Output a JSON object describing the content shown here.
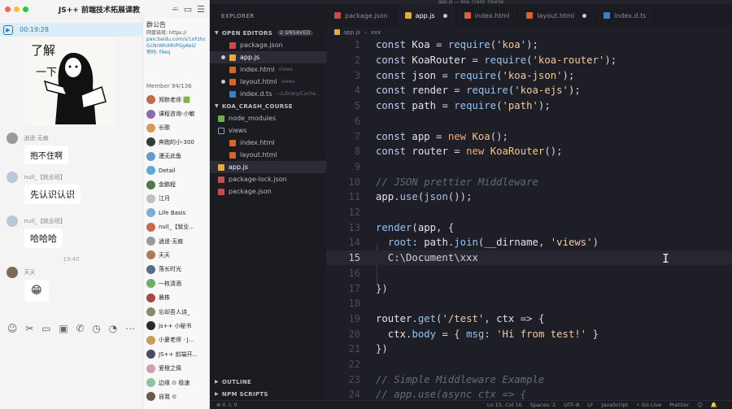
{
  "chat": {
    "title": "JS++ 前端技术拓展课教",
    "timer": "00:19:28",
    "sticker_text": [
      "了解",
      "一下"
    ],
    "messages": [
      {
        "sender": "逍遥·无痕",
        "text": "抱不住啊"
      },
      {
        "sender": "null_【就业班】",
        "text": "先认识认识"
      },
      {
        "sender": "null_【就业班】",
        "text": "哈哈哈"
      },
      {
        "sender": "天天",
        "text": "😁"
      }
    ],
    "time_divider": "19:40",
    "toolbar_icons": [
      "emoji-icon",
      "scissors-icon",
      "folder-icon",
      "image-icon",
      "phone-icon",
      "history-icon",
      "clock-icon",
      "more-icon"
    ],
    "group": {
      "notice_title": "群公告",
      "notice_lines": [
        "网盘链接: https://",
        "pan.baidu.com/s/1xFzhc",
        "GcNrWkd4hPGgAeI2",
        "密码: f4eq"
      ],
      "member_count": "Member 94/136",
      "members": [
        "郑默老师 🟩",
        "课程咨询-小敏",
        "长歌",
        "奔跑的小-300",
        "漫无此鱼",
        "Detail",
        "金鹏程",
        "江月",
        "Life Basis",
        "null_【就业...",
        "逍遥·无痕",
        "天天",
        "落长时光",
        "一枚清酒",
        "晨株",
        "忘却吾人诗_",
        "js++ 小秘书",
        "小夏老师 · J...",
        "JS++ 前端开...",
        "爱橙之佩",
        "边缘 ⊙ 极速",
        "自我 ⊙"
      ]
    }
  },
  "vscode": {
    "window_title": "app.js — koa_crash_course",
    "explorer_title": "EXPLORER",
    "open_editors": {
      "label": "OPEN EDITORS",
      "badge": "2 UNSAVED",
      "items": [
        {
          "name": "package.json",
          "hint": "",
          "icon": "json",
          "dirty": false
        },
        {
          "name": "app.js",
          "hint": "",
          "icon": "js",
          "dirty": true
        },
        {
          "name": "index.html",
          "hint": "views",
          "icon": "html",
          "dirty": false
        },
        {
          "name": "layout.html",
          "hint": "views",
          "icon": "html",
          "dirty": true
        },
        {
          "name": "index.d.ts",
          "hint": "~/Library/Cache...",
          "icon": "ts",
          "dirty": false
        }
      ]
    },
    "project": {
      "label": "KOA_CRASH_COURSE",
      "items": [
        {
          "name": "node_modules",
          "icon": "node",
          "depth": 1
        },
        {
          "name": "views",
          "icon": "folder",
          "depth": 1
        },
        {
          "name": "index.html",
          "icon": "html",
          "depth": 2
        },
        {
          "name": "layout.html",
          "icon": "html",
          "depth": 2
        },
        {
          "name": "app.js",
          "icon": "js",
          "depth": 1
        },
        {
          "name": "package-lock.json",
          "icon": "json",
          "depth": 1
        },
        {
          "name": "package.json",
          "icon": "json",
          "depth": 1
        }
      ]
    },
    "bottom_sections": [
      "OUTLINE",
      "NPM SCRIPTS"
    ],
    "tabs": [
      {
        "name": "package.json",
        "icon": "json",
        "active": false,
        "dirty": false
      },
      {
        "name": "app.js",
        "icon": "js",
        "active": true,
        "dirty": true
      },
      {
        "name": "index.html",
        "icon": "html",
        "active": false,
        "dirty": false
      },
      {
        "name": "layout.html",
        "icon": "html",
        "active": false,
        "dirty": true
      },
      {
        "name": "index.d.ts",
        "icon": "ts",
        "active": false,
        "dirty": false
      }
    ],
    "breadcrumb": [
      "app.js",
      "xxx"
    ],
    "current_line": 15,
    "code_lines": [
      {
        "n": 1,
        "t": [
          [
            "kw",
            "const "
          ],
          [
            "id",
            "Koa "
          ],
          [
            "punc",
            "= "
          ],
          [
            "fn",
            "require"
          ],
          [
            "punc",
            "("
          ],
          [
            "str",
            "'koa'"
          ],
          [
            "punc",
            ");"
          ]
        ]
      },
      {
        "n": 2,
        "t": [
          [
            "kw",
            "const "
          ],
          [
            "id",
            "KoaRouter "
          ],
          [
            "punc",
            "= "
          ],
          [
            "fn",
            "require"
          ],
          [
            "punc",
            "("
          ],
          [
            "str",
            "'koa-router'"
          ],
          [
            "punc",
            ");"
          ]
        ]
      },
      {
        "n": 3,
        "t": [
          [
            "kw",
            "const "
          ],
          [
            "id",
            "json "
          ],
          [
            "punc",
            "= "
          ],
          [
            "fn",
            "require"
          ],
          [
            "punc",
            "("
          ],
          [
            "str",
            "'koa-json'"
          ],
          [
            "punc",
            ");"
          ]
        ]
      },
      {
        "n": 4,
        "t": [
          [
            "kw",
            "const "
          ],
          [
            "id",
            "render "
          ],
          [
            "punc",
            "= "
          ],
          [
            "fn",
            "require"
          ],
          [
            "punc",
            "("
          ],
          [
            "str",
            "'koa-ejs'"
          ],
          [
            "punc",
            ");"
          ]
        ]
      },
      {
        "n": 5,
        "t": [
          [
            "kw",
            "const "
          ],
          [
            "id",
            "path "
          ],
          [
            "punc",
            "= "
          ],
          [
            "fn",
            "require"
          ],
          [
            "punc",
            "("
          ],
          [
            "str",
            "'path'"
          ],
          [
            "punc",
            ");"
          ]
        ]
      },
      {
        "n": 6,
        "t": []
      },
      {
        "n": 7,
        "t": [
          [
            "kw",
            "const "
          ],
          [
            "id",
            "app "
          ],
          [
            "punc",
            "= "
          ],
          [
            "new",
            "new "
          ],
          [
            "cls",
            "Koa"
          ],
          [
            "punc",
            "();"
          ]
        ]
      },
      {
        "n": 8,
        "t": [
          [
            "kw",
            "const "
          ],
          [
            "id",
            "router "
          ],
          [
            "punc",
            "= "
          ],
          [
            "new",
            "new "
          ],
          [
            "cls",
            "KoaRouter"
          ],
          [
            "punc",
            "();"
          ]
        ]
      },
      {
        "n": 9,
        "t": []
      },
      {
        "n": 10,
        "t": [
          [
            "cm",
            "// JSON prettier Middleware"
          ]
        ]
      },
      {
        "n": 11,
        "t": [
          [
            "id",
            "app"
          ],
          [
            "punc",
            "."
          ],
          [
            "fn",
            "use"
          ],
          [
            "punc",
            "("
          ],
          [
            "fn",
            "json"
          ],
          [
            "punc",
            "());"
          ]
        ]
      },
      {
        "n": 12,
        "t": []
      },
      {
        "n": 13,
        "t": [
          [
            "fn",
            "render"
          ],
          [
            "punc",
            "("
          ],
          [
            "id",
            "app"
          ],
          [
            "punc",
            ", {"
          ]
        ]
      },
      {
        "n": 14,
        "t": [
          [
            "id",
            "  "
          ],
          [
            "key",
            "root"
          ],
          [
            "punc",
            ": "
          ],
          [
            "id",
            "path"
          ],
          [
            "punc",
            "."
          ],
          [
            "fn",
            "join"
          ],
          [
            "punc",
            "("
          ],
          [
            "id",
            "__dirname"
          ],
          [
            "punc",
            ", "
          ],
          [
            "str",
            "'views'"
          ],
          [
            "punc",
            ")"
          ]
        ]
      },
      {
        "n": 15,
        "t": [
          [
            "cursor-text",
            "  C:\\Document\\xxx"
          ]
        ]
      },
      {
        "n": 16,
        "t": []
      },
      {
        "n": 17,
        "t": [
          [
            "punc",
            "})"
          ]
        ]
      },
      {
        "n": 18,
        "t": []
      },
      {
        "n": 19,
        "t": [
          [
            "id",
            "router"
          ],
          [
            "punc",
            "."
          ],
          [
            "fn",
            "get"
          ],
          [
            "punc",
            "("
          ],
          [
            "str",
            "'/test'"
          ],
          [
            "punc",
            ", "
          ],
          [
            "id",
            "ctx "
          ],
          [
            "kw",
            "=> "
          ],
          [
            "punc",
            "{"
          ]
        ]
      },
      {
        "n": 20,
        "t": [
          [
            "id",
            "  ctx"
          ],
          [
            "punc",
            "."
          ],
          [
            "key",
            "body "
          ],
          [
            "punc",
            "= { "
          ],
          [
            "key",
            "msg"
          ],
          [
            "punc",
            ": "
          ],
          [
            "str",
            "'Hi from test!'"
          ],
          [
            "punc",
            " }"
          ]
        ]
      },
      {
        "n": 21,
        "t": [
          [
            "punc",
            "})"
          ]
        ]
      },
      {
        "n": 22,
        "t": []
      },
      {
        "n": 23,
        "t": [
          [
            "cm",
            "// Simple Middleware Example"
          ]
        ]
      },
      {
        "n": 24,
        "t": [
          [
            "cm",
            "// app.use(async ctx => {"
          ]
        ]
      }
    ],
    "status": {
      "left": [
        "⊗ 0 ⚠ 0"
      ],
      "right": [
        "Ln 15, Col 16",
        "Spaces: 2",
        "UTF-8",
        "LF",
        "JavaScript",
        "⚡ Go Live",
        "Prettier",
        "☺",
        "🔔"
      ]
    }
  }
}
